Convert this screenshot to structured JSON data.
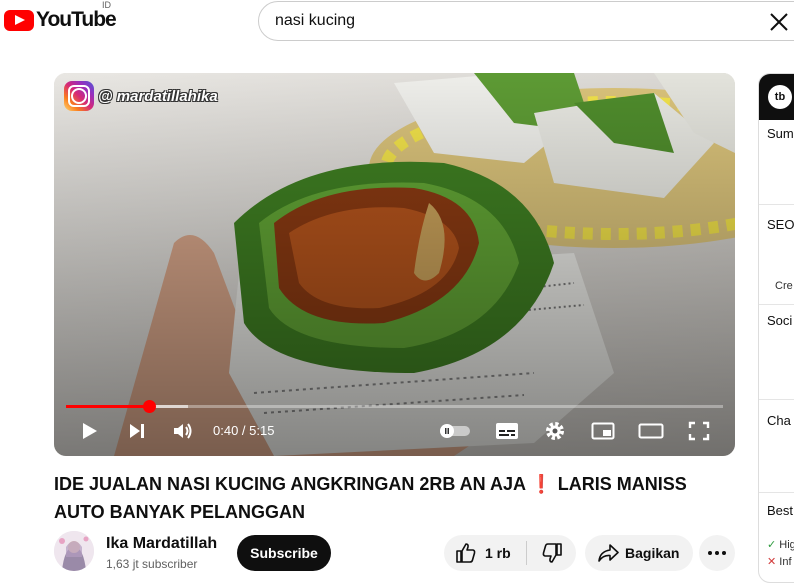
{
  "header": {
    "logo_text": "YouTube",
    "country_code": "ID",
    "search_value": "nasi kucing"
  },
  "player": {
    "watermark_handle": "@ mardatillahika",
    "time_current": "0:40",
    "time_total": "5:15",
    "time_display": "0:40 / 5:15",
    "progress_fraction": 0.127,
    "buffer_fraction": 0.185
  },
  "video": {
    "title_line1": "IDE JUALAN NASI KUCING ANGKRINGAN 2RB AN AJA ❗ LARIS MANISS",
    "title_line2": "AUTO BANYAK PELANGGAN"
  },
  "channel": {
    "name": "Ika Mardatillah",
    "subscribers": "1,63 jt subscriber",
    "subscribe_label": "Subscribe"
  },
  "actions": {
    "like_count": "1 rb",
    "share_label": "Bagikan"
  },
  "side_panel": {
    "logo": "tb",
    "items": [
      "Sum",
      "SEO",
      "Cre",
      "Soci",
      "Cha",
      "Best"
    ],
    "checks": [
      "Hig",
      "Inf"
    ]
  },
  "colors": {
    "brand_red": "#ff0000",
    "subscribe_bg": "#0f0f0f",
    "button_bg": "#f2f2f2"
  }
}
